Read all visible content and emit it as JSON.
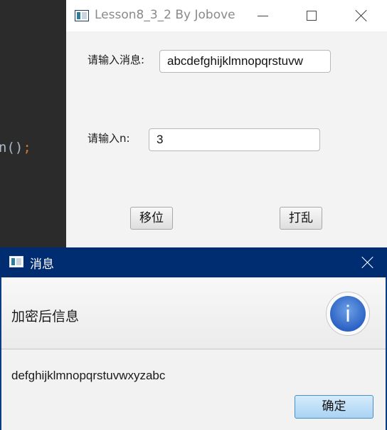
{
  "editor": {
    "code": "n()",
    "semicolon": ";"
  },
  "main_window": {
    "title": "Lesson8_3_2 By Jobove",
    "message_label": "请输入消息:",
    "message_value": "abcdefghijklmnopqrstuvw",
    "n_label": "请输入n:",
    "n_value": "3",
    "shift_button": "移位",
    "shuffle_button": "打乱"
  },
  "dialog": {
    "title": "消息",
    "header": "加密后信息",
    "info_glyph": "i",
    "content": "defghijklmnopqrstuvwxyzabc",
    "ok_button": "确定",
    "colors": {
      "titlebar": "#002d72",
      "ok_button": "#a9d3f4",
      "info": "#2c62c4"
    }
  }
}
